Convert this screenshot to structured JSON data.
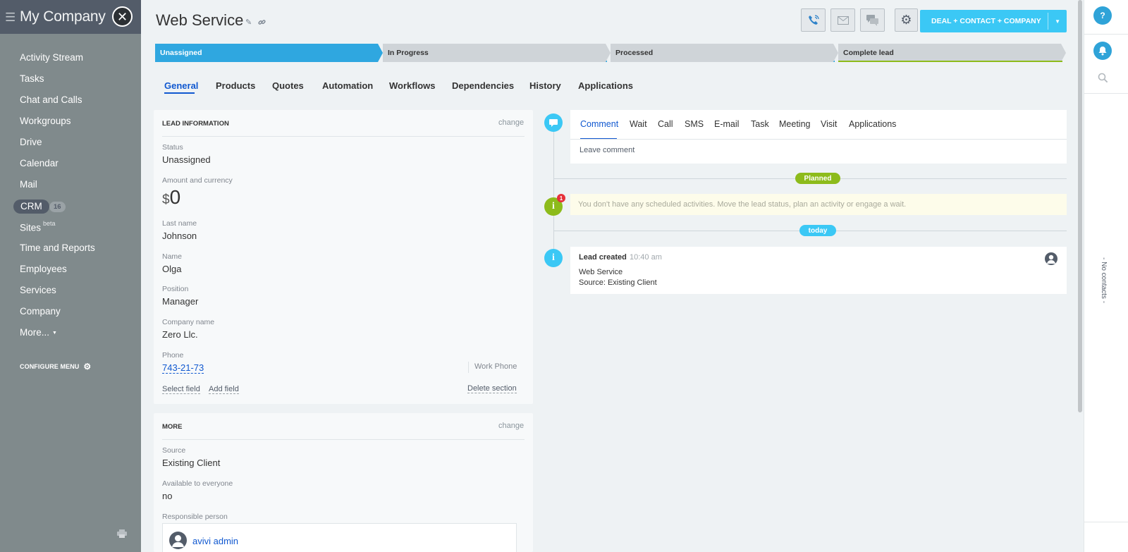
{
  "sidebar": {
    "brand": "My Company",
    "items": [
      {
        "label": "Activity Stream"
      },
      {
        "label": "Tasks"
      },
      {
        "label": "Chat and Calls"
      },
      {
        "label": "Workgroups"
      },
      {
        "label": "Drive"
      },
      {
        "label": "Calendar"
      },
      {
        "label": "Mail"
      },
      {
        "label": "CRM",
        "count": "16"
      },
      {
        "label": "Sites",
        "badge": "beta"
      },
      {
        "label": "Time and Reports"
      },
      {
        "label": "Employees"
      },
      {
        "label": "Services"
      },
      {
        "label": "Company"
      },
      {
        "label": "More..."
      }
    ],
    "configure": "CONFIGURE MENU"
  },
  "header": {
    "title": "Web Service",
    "convert_button": "DEAL + CONTACT + COMPANY"
  },
  "stages": [
    {
      "label": "Unassigned",
      "color": "#2fa7e0"
    },
    {
      "label": "In Progress",
      "color": "#cfd4d8"
    },
    {
      "label": "Processed",
      "color": "#cfd4d8"
    },
    {
      "label": "Complete lead",
      "color": "#cfd4d8"
    }
  ],
  "tabs": [
    "General",
    "Products",
    "Quotes",
    "Automation",
    "Workflows",
    "Dependencies",
    "History",
    "Applications"
  ],
  "lead_info": {
    "heading": "LEAD INFORMATION",
    "change": "change",
    "status_label": "Status",
    "status": "Unassigned",
    "amount_label": "Amount and currency",
    "currency": "$",
    "amount": "0",
    "last_name_label": "Last name",
    "last_name": "Johnson",
    "name_label": "Name",
    "name": "Olga",
    "position_label": "Position",
    "position": "Manager",
    "company_label": "Company name",
    "company": "Zero Llc.",
    "phone_label": "Phone",
    "phone": "743-21-73",
    "phone_type": "Work Phone",
    "select_field": "Select field",
    "add_field": "Add field",
    "delete_section": "Delete section"
  },
  "more": {
    "heading": "MORE",
    "change": "change",
    "source_label": "Source",
    "source": "Existing Client",
    "available_label": "Available to everyone",
    "available": "no",
    "responsible_label": "Responsible person",
    "responsible": "avivi admin"
  },
  "timeline": {
    "tabs": [
      "Comment",
      "Wait",
      "Call",
      "SMS",
      "E-mail",
      "Task",
      "Meeting",
      "Visit",
      "Applications"
    ],
    "placeholder": "Leave comment",
    "planned": "Planned",
    "notice_count": "1",
    "notice": "You don't have any scheduled activities. Move the lead status, plan an activity or engage a wait.",
    "today": "today",
    "event_title": "Lead created",
    "event_time": "10:40 am",
    "event_line1": "Web Service",
    "event_line2": "Source: Existing Client"
  },
  "right_panel": {
    "help": "?",
    "no_contacts": "- No contacts -"
  },
  "colors": {
    "accent": "#3bc8f5",
    "link": "#1058d0",
    "green": "#8dbb1b"
  }
}
